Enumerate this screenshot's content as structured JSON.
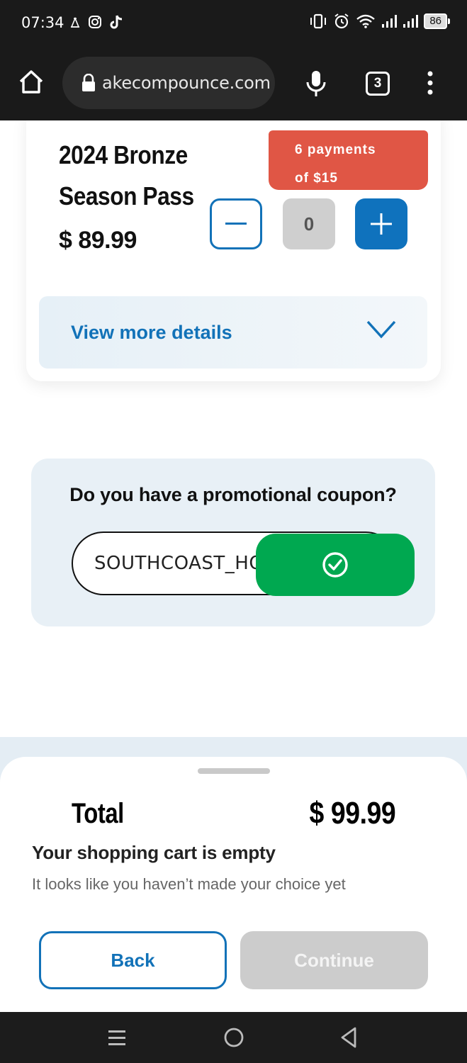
{
  "status_bar": {
    "time": "07:34",
    "battery": "86",
    "icons": [
      "notification-icon",
      "instagram-icon",
      "tiktok-icon",
      "vibrate-icon",
      "alarm-icon",
      "wifi-icon",
      "signal-icon",
      "signal-icon-2",
      "battery-icon"
    ]
  },
  "browser": {
    "url": "akecompounce.com",
    "tab_count": "3",
    "icons": [
      "home-icon",
      "lock-icon",
      "mic-icon",
      "tabs-icon",
      "menu-icon"
    ]
  },
  "product": {
    "title": "2024 Bronze Season Pass",
    "payments_line1": "6 payments",
    "payments_line2": "of $15",
    "price": "$ 89.99",
    "quantity": "0",
    "details_label": "View more details",
    "colors": {
      "badge": "#e05645",
      "accent": "#1272b8"
    }
  },
  "coupon": {
    "question": "Do you have a promotional coupon?",
    "value": "SOUTHCOAST_HO",
    "apply_color": "#00a850"
  },
  "summary": {
    "total_label": "Total",
    "total_value": "$ 99.99",
    "cart_empty": "Your shopping cart is empty",
    "cart_hint": "It looks like you haven’t made your choice yet",
    "back_label": "Back",
    "continue_label": "Continue"
  },
  "nav": {
    "icons": [
      "recent-apps-icon",
      "home-circle-icon",
      "back-triangle-icon"
    ]
  }
}
